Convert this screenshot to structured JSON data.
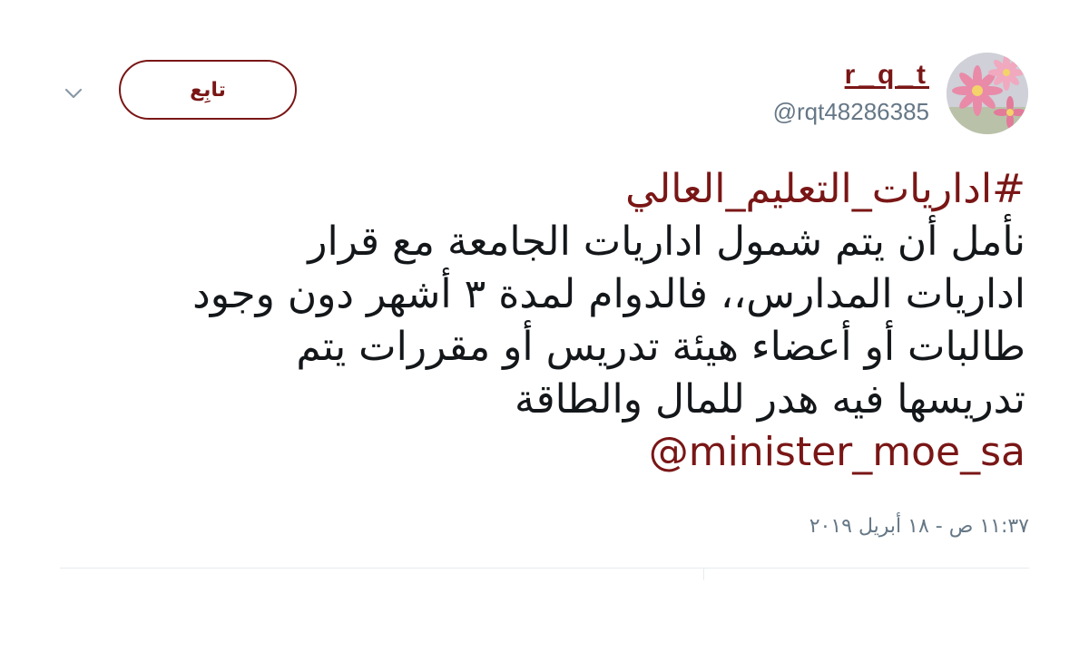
{
  "user": {
    "display_name": "r_q_t",
    "handle": "@rqt48286385",
    "avatar": "pink-flowers-avatar"
  },
  "actions": {
    "follow_label": "تابِع",
    "more_icon": "chevron-down-icon"
  },
  "tweet": {
    "hashtag": "#اداريات_التعليم_العالي",
    "lines": [
      "نأمل أن يتم شمول اداريات الجامعة مع قرار",
      "اداريات المدارس،، فالدوام لمدة ٣ أشهر دون وجود",
      "طالبات أو أعضاء هيئة تدريس أو مقررات يتم",
      "تدريسها فيه هدر للمال والطاقة"
    ],
    "mention": "@minister_moe_sa",
    "timestamp": "١١:٣٧ ص - ١٨ أبريل ٢٠١٩"
  },
  "colors": {
    "accent": "#7a1616",
    "text": "#14171a",
    "muted": "#657786",
    "divider": "#e6ecf0"
  }
}
